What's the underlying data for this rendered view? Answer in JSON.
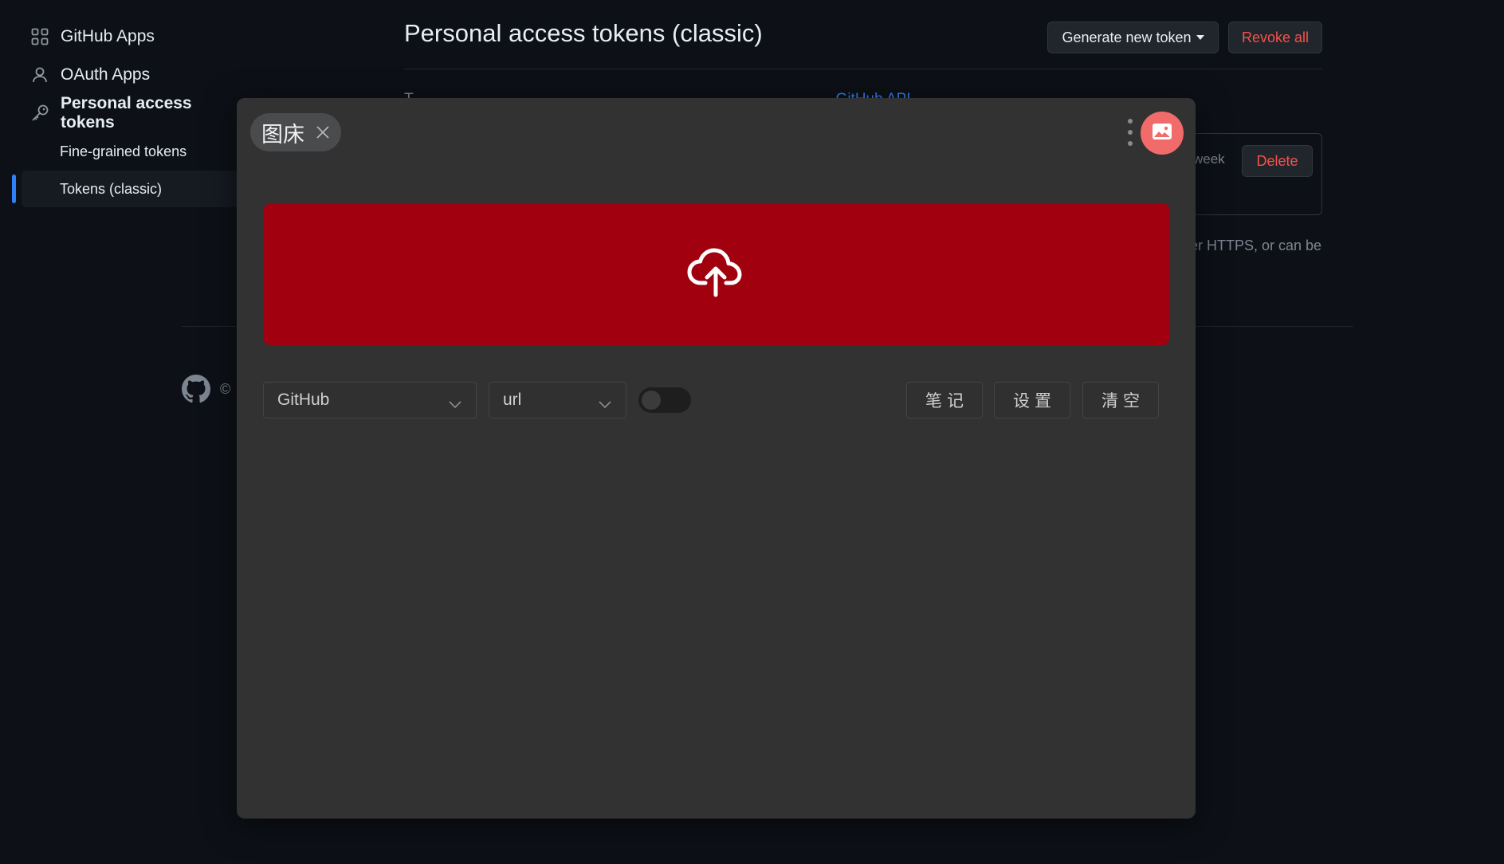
{
  "sidebar": {
    "items": [
      {
        "label": "GitHub Apps",
        "icon": "apps-grid-icon"
      },
      {
        "label": "OAuth Apps",
        "icon": "person-icon"
      },
      {
        "label": "Personal access tokens",
        "icon": "key-icon"
      }
    ],
    "sub_items": [
      {
        "label": "Fine-grained tokens"
      },
      {
        "label": "Tokens (classic)",
        "selected": true
      }
    ]
  },
  "main": {
    "title": "Personal access tokens (classic)",
    "generate_button": "Generate new token",
    "revoke_button": "Revoke all",
    "intro_visible": "T",
    "intro_link": "GitHub API",
    "token_expiry_fragment": "week",
    "delete_button": "Delete",
    "https_fragment": "er HTTPS, or can be",
    "footer_copyright": "©"
  },
  "modal": {
    "tab_label": "图床",
    "upload_icon": "cloud-upload-icon",
    "host_select": {
      "value": "GitHub"
    },
    "format_select": {
      "value": "url"
    },
    "toggle_on": false,
    "buttons": {
      "notes": "笔记",
      "settings": "设置",
      "clear": "清空"
    }
  },
  "colors": {
    "page_bg": "#0d1117",
    "modal_bg": "#323233",
    "upload_zone": "#a1000f",
    "avatar_bg": "#f26b6b",
    "danger_text": "#f85149",
    "accent": "#2f81f7"
  }
}
